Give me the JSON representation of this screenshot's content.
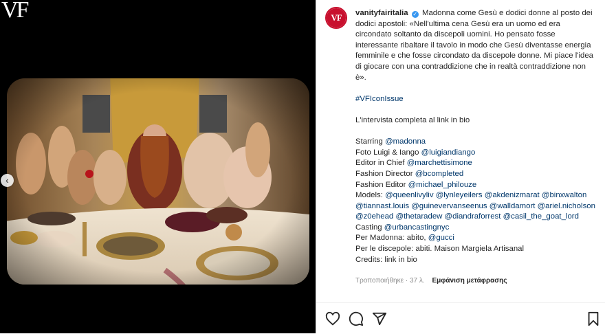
{
  "brand": {
    "logo_text": "VF",
    "avatar_text": "VF",
    "accent": "#c8102e"
  },
  "post": {
    "username": "vanityfairitalia",
    "verified_icon": "verified-badge-icon",
    "text_first": "Madonna come Gesù e dodici donne al posto dei dodici apostoli: «Nell'ultima cena Gesù era un uomo ed era circondato soltanto da discepoli uomini. Ho pensato fosse interessante ribaltare il tavolo in modo che Gesù diventasse energia femminile e che fosse circondato da discepole donne. Mi piace l'idea di giocare con una contraddizione che in realtà contraddizione non è».",
    "hashtag": "#VFIconIssue",
    "interview": "L'intervista completa al link in bio",
    "credits": [
      {
        "label": "Starring ",
        "handles": [
          "@madonna"
        ]
      },
      {
        "label": "Foto Luigi & Iango ",
        "handles": [
          "@luigiandiango"
        ]
      },
      {
        "label": "Editor in Chief ",
        "handles": [
          "@marchettisimone"
        ]
      },
      {
        "label": "Fashion Director ",
        "handles": [
          "@bcompleted"
        ]
      },
      {
        "label": "Fashion Editor ",
        "handles": [
          "@michael_philouze"
        ]
      },
      {
        "label": "Models: ",
        "handles": [
          "@queenlivyliv",
          "@lynleyeilers",
          "@akdenizmarat",
          "@binxwalton",
          "@tiannast.louis",
          "@guinevervanseenus",
          "@walldamort",
          "@ariel.nicholson",
          "@z0ehead",
          "@thetaradew",
          "@diandraforrest",
          "@casil_the_goat_lord"
        ]
      },
      {
        "label": "Casting ",
        "handles": [
          "@urbancastingnyc"
        ]
      },
      {
        "label": "Per Madonna: abito, ",
        "handles": [
          "@gucci"
        ]
      },
      {
        "label": "Per le discepole: abiti. Maison Margiela Artisanal",
        "handles": []
      },
      {
        "label": "Credits: link in bio",
        "handles": []
      }
    ],
    "edited": "Τροποποιήθηκε · 37 λ.",
    "translate": "Εμφάνιση μετάφρασης"
  },
  "actions": {
    "like": "heart-icon",
    "comment": "comment-icon",
    "share": "share-icon",
    "save": "bookmark-icon"
  },
  "carousel": {
    "prev": "‹"
  }
}
